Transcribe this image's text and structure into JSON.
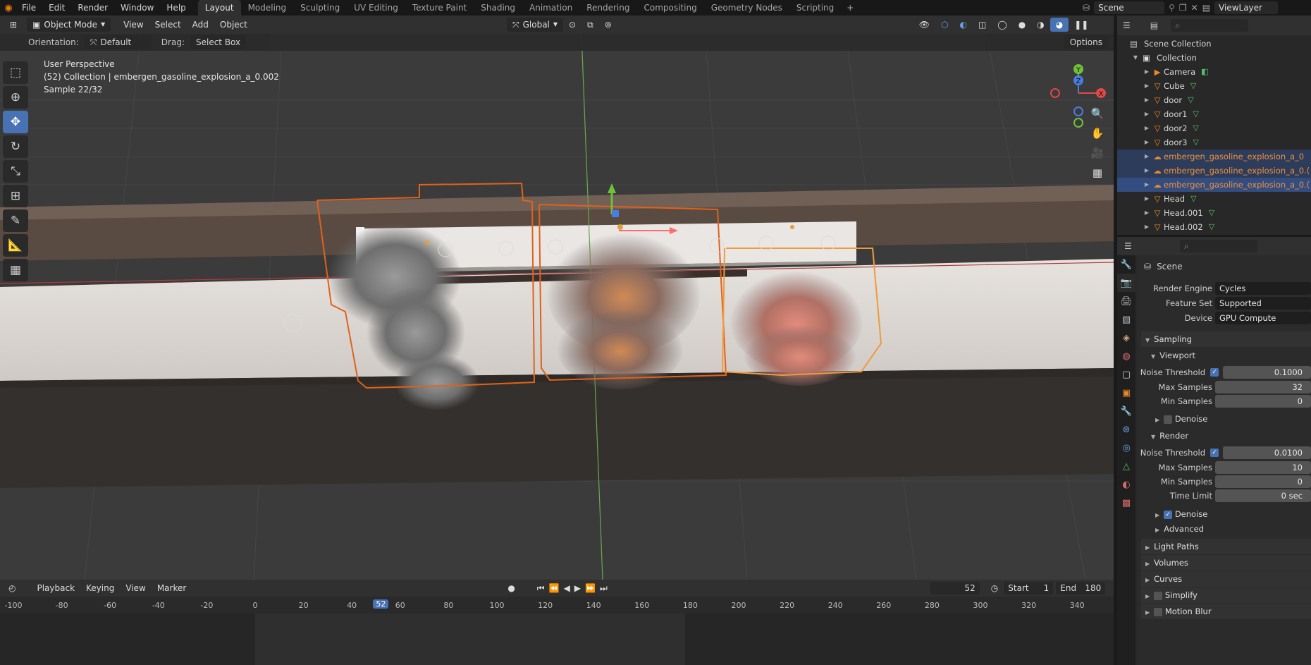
{
  "topbar": {
    "menus": [
      "File",
      "Edit",
      "Render",
      "Window",
      "Help"
    ],
    "workspaces": [
      "Layout",
      "Modeling",
      "Sculpting",
      "UV Editing",
      "Texture Paint",
      "Shading",
      "Animation",
      "Rendering",
      "Compositing",
      "Geometry Nodes",
      "Scripting"
    ],
    "add_tab": "+",
    "scene_name": "Scene",
    "view_layer": "ViewLayer"
  },
  "viewport": {
    "mode": "Object Mode",
    "menus": [
      "View",
      "Select",
      "Add",
      "Object"
    ],
    "transform_orientation": "Global",
    "orientation_label": "Orientation:",
    "orientation_value": "Default",
    "drag_label": "Drag:",
    "drag_value": "Select Box",
    "options_label": "Options",
    "overlay_line1": "User Perspective",
    "overlay_line2": "(52) Collection | embergen_gasoline_explosion_a_0.002",
    "overlay_line3": "Sample 22/32",
    "gizmo_axes": {
      "y": "Y",
      "z": "Z",
      "x": "X"
    }
  },
  "timeline": {
    "menus": [
      "Playback",
      "Keying",
      "View",
      "Marker"
    ],
    "current_frame": "52",
    "start_label": "Start",
    "start_value": "1",
    "end_label": "End",
    "end_value": "180",
    "ruler_ticks": [
      "-100",
      "-80",
      "-60",
      "-40",
      "-20",
      "0",
      "20",
      "40",
      "52",
      "60",
      "80",
      "100",
      "120",
      "140",
      "160",
      "180",
      "200",
      "220",
      "240",
      "260",
      "280",
      "300",
      "320",
      "340"
    ]
  },
  "outliner": {
    "root": "Scene Collection",
    "collection": "Collection",
    "items": [
      {
        "name": "Camera",
        "icon": "camera-icon",
        "selected": false,
        "highlight": false
      },
      {
        "name": "Cube",
        "icon": "mesh-icon",
        "selected": false,
        "highlight": false
      },
      {
        "name": "door",
        "icon": "mesh-icon",
        "selected": false,
        "highlight": false
      },
      {
        "name": "door1",
        "icon": "mesh-icon",
        "selected": false,
        "highlight": false
      },
      {
        "name": "door2",
        "icon": "mesh-icon",
        "selected": false,
        "highlight": false
      },
      {
        "name": "door3",
        "icon": "mesh-icon",
        "selected": false,
        "highlight": false
      },
      {
        "name": "embergen_gasoline_explosion_a_0",
        "icon": "volume-icon",
        "selected": false,
        "highlight": true
      },
      {
        "name": "embergen_gasoline_explosion_a_0.(",
        "icon": "volume-icon",
        "selected": false,
        "highlight": true
      },
      {
        "name": "embergen_gasoline_explosion_a_0.(",
        "icon": "volume-icon",
        "selected": true,
        "highlight": true
      },
      {
        "name": "Head",
        "icon": "mesh-icon",
        "selected": false,
        "highlight": false
      },
      {
        "name": "Head.001",
        "icon": "mesh-icon",
        "selected": false,
        "highlight": false
      },
      {
        "name": "Head.002",
        "icon": "mesh-icon",
        "selected": false,
        "highlight": false
      }
    ]
  },
  "properties": {
    "context": "Scene",
    "render_engine_label": "Render Engine",
    "render_engine": "Cycles",
    "feature_set_label": "Feature Set",
    "feature_set": "Supported",
    "device_label": "Device",
    "device": "GPU Compute",
    "sampling": "Sampling",
    "viewport": "Viewport",
    "vp_noise_label": "Noise Threshold",
    "vp_noise": "0.1000",
    "vp_max_label": "Max Samples",
    "vp_max": "32",
    "vp_min_label": "Min Samples",
    "vp_min": "0",
    "vp_denoise": "Denoise",
    "render": "Render",
    "r_noise_label": "Noise Threshold",
    "r_noise": "0.0100",
    "r_max_label": "Max Samples",
    "r_max": "10",
    "r_min_label": "Min Samples",
    "r_min": "0",
    "r_time_label": "Time Limit",
    "r_time": "0 sec",
    "r_denoise": "Denoise",
    "advanced": "Advanced",
    "light_paths": "Light Paths",
    "volumes": "Volumes",
    "curves": "Curves",
    "simplify": "Simplify",
    "motion_blur": "Motion Blur"
  },
  "colors": {
    "accent": "#4772b3",
    "selection_orange": "#f0913a",
    "blender_orange": "#e87d0d"
  }
}
